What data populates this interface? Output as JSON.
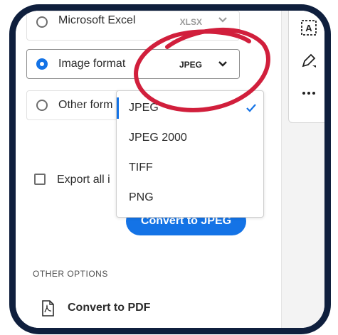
{
  "options": {
    "microsoft_excel": {
      "label": "Microsoft Excel",
      "value": "XLSX"
    },
    "image_format": {
      "label": "Image format",
      "value": "JPEG"
    },
    "other_format": {
      "label": "Other form"
    }
  },
  "dropdown": {
    "items": [
      {
        "label": "JPEG",
        "selected": true
      },
      {
        "label": "JPEG 2000",
        "selected": false
      },
      {
        "label": "TIFF",
        "selected": false
      },
      {
        "label": "PNG",
        "selected": false
      }
    ]
  },
  "export_all": {
    "label": "Export all i"
  },
  "convert_button": {
    "label": "Convert to JPEG"
  },
  "other_options": {
    "title": "OTHER OPTIONS",
    "convert_to_pdf": {
      "label": "Convert to PDF"
    }
  },
  "colors": {
    "accent": "#1473e6",
    "frame": "#0f1f3d",
    "annotation": "#d11f3c"
  },
  "icons": {
    "rail": [
      "text-box-icon",
      "pen-sign-icon",
      "more-icon"
    ],
    "convert_to_pdf": "pdf-file-icon"
  }
}
